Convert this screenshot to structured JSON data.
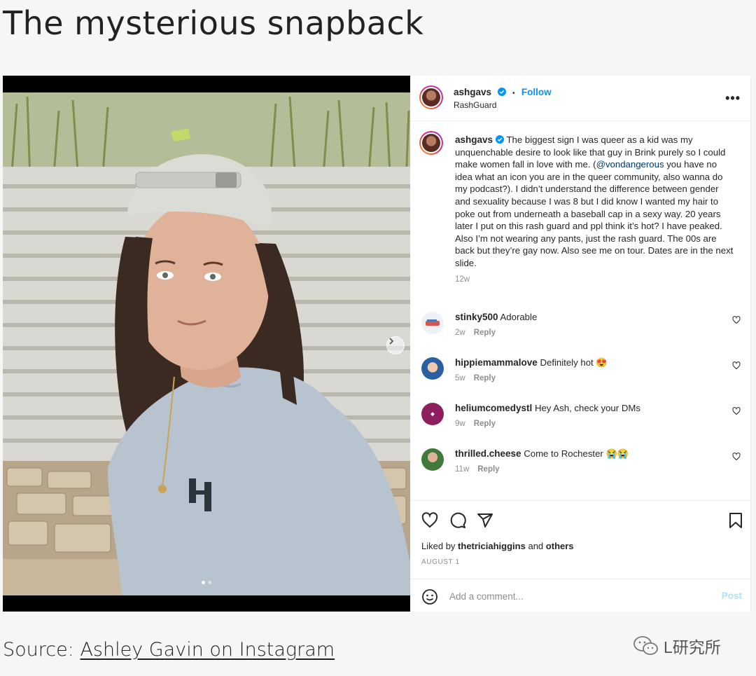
{
  "headline": "The mysterious snapback",
  "post": {
    "username": "ashgavs",
    "follow_label": "Follow",
    "separator": "•",
    "subtitle": "RashGuard",
    "more_label": "•••",
    "caption_user": "ashgavs",
    "caption_part1": "The biggest sign I was queer as a kid was my unquenchable desire to look like that guy in Brink purely so I could make women fall in love with me. (",
    "caption_mention": "@vondangerous",
    "caption_part2": " you have no idea what an icon you are in the queer community, also wanna do my podcast?). I didn’t understand the difference between gender and sexuality because I was 8 but I did know I wanted my hair to poke out from underneath a baseball cap in a sexy way. 20 years later I put on this rash guard and ppl think it’s hot? I have peaked. Also I’m not wearing any pants, just the rash guard. The 00s are back but they’re gay now. Also see me on tour. Dates are in the next slide.",
    "caption_age": "12w",
    "comments": [
      {
        "user": "stinky500",
        "text": "Adorable",
        "age": "2w",
        "reply": "Reply"
      },
      {
        "user": "hippiemammalove",
        "text": "Definitely hot 😍",
        "age": "5w",
        "reply": "Reply"
      },
      {
        "user": "heliumcomedystl",
        "text": "Hey Ash, check your DMs",
        "age": "9w",
        "reply": "Reply"
      },
      {
        "user": "thrilled.cheese",
        "text": "Come to Rochester 😭😭",
        "age": "11w",
        "reply": "Reply"
      }
    ],
    "liked_by_prefix": "Liked by",
    "liked_by_user": "thetriciahiggins",
    "liked_by_and": "and",
    "liked_by_others": "others",
    "date": "AUGUST 1",
    "comment_placeholder": "Add a comment...",
    "post_label": "Post"
  },
  "source": {
    "prefix": "Source:",
    "link_text": "Ashley Gavin on Instagram"
  },
  "watermark": "L研究所",
  "colors": {
    "link_blue": "#0095f6",
    "mention": "#00376b",
    "muted": "#8e8e8e"
  },
  "icons": [
    "verified-badge-icon",
    "more-options-icon",
    "next-photo-icon",
    "heart-icon",
    "comment-icon",
    "share-icon",
    "bookmark-icon",
    "emoji-icon",
    "wechat-icon"
  ],
  "carousel": {
    "slides": 2,
    "current": 1
  }
}
